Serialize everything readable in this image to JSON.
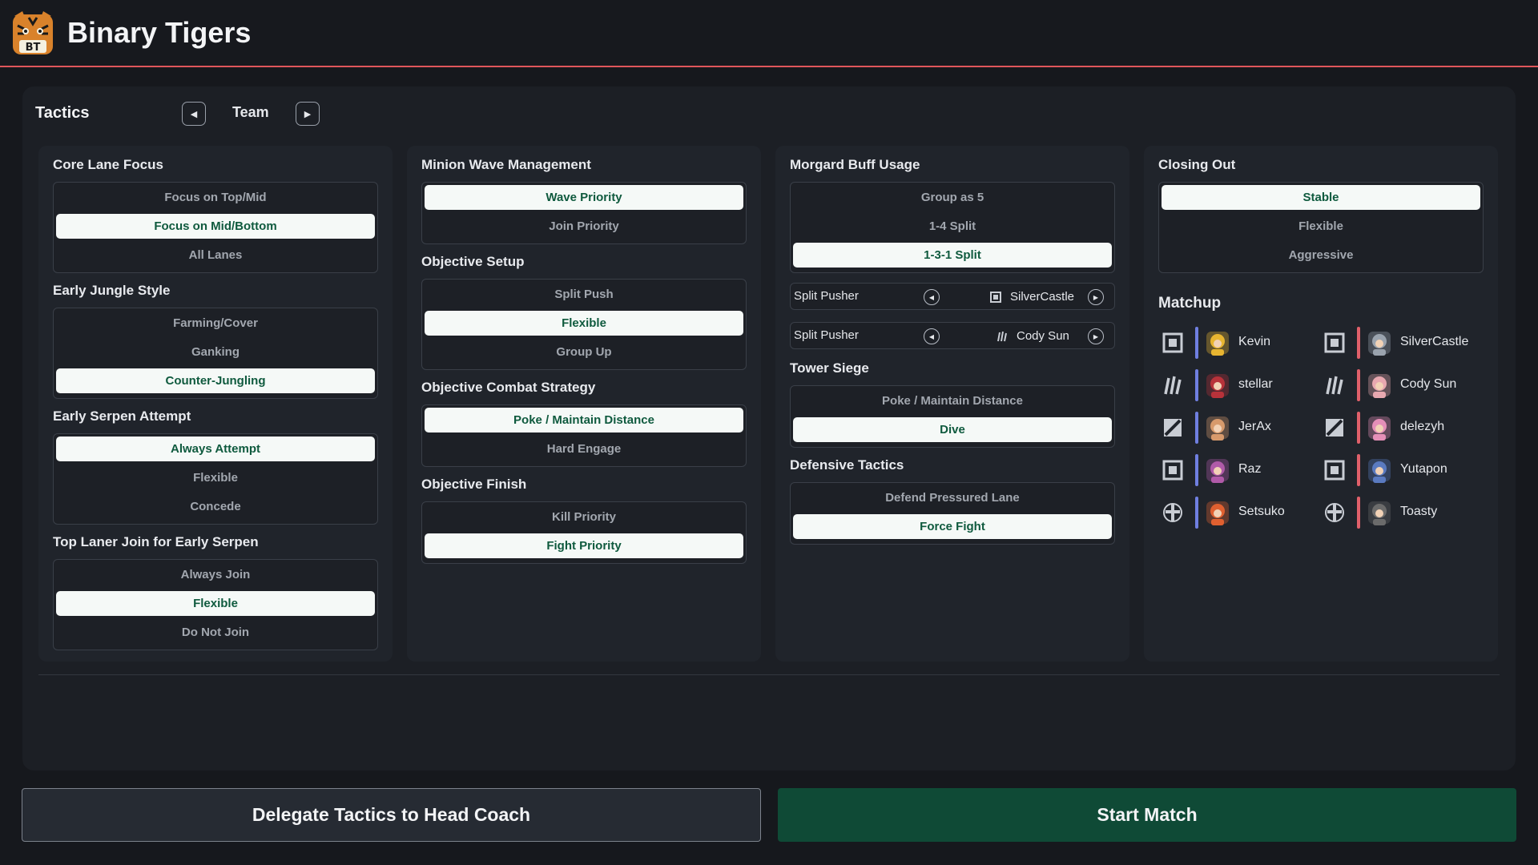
{
  "header": {
    "title": "Binary Tigers",
    "logo": "tiger-logo",
    "logo_text": "BT"
  },
  "tactics": {
    "title": "Tactics",
    "mode": "Team"
  },
  "columns": [
    {
      "sections": [
        {
          "title": "Core Lane Focus",
          "options": [
            "Focus on Top/Mid",
            "Focus on Mid/Bottom",
            "All Lanes"
          ],
          "selected": 1
        },
        {
          "title": "Early Jungle Style",
          "options": [
            "Farming/Cover",
            "Ganking",
            "Counter-Jungling"
          ],
          "selected": 2
        },
        {
          "title": "Early Serpen Attempt",
          "options": [
            "Always Attempt",
            "Flexible",
            "Concede"
          ],
          "selected": 0
        },
        {
          "title": "Top Laner Join for Early Serpen",
          "options": [
            "Always Join",
            "Flexible",
            "Do Not Join"
          ],
          "selected": 1
        }
      ]
    },
    {
      "sections": [
        {
          "title": "Minion Wave Management",
          "options": [
            "Wave Priority",
            "Join Priority"
          ],
          "selected": 0
        },
        {
          "title": "Objective Setup",
          "options": [
            "Split Push",
            "Flexible",
            "Group Up"
          ],
          "selected": 1
        },
        {
          "title": "Objective Combat Strategy",
          "options": [
            "Poke / Maintain Distance",
            "Hard Engage"
          ],
          "selected": 0
        },
        {
          "title": "Objective Finish",
          "options": [
            "Kill Priority",
            "Fight Priority"
          ],
          "selected": 1
        }
      ]
    },
    {
      "sections": [
        {
          "title": "Morgard Buff Usage",
          "options": [
            "Group as 5",
            "1-4 Split",
            "1-3-1 Split"
          ],
          "selected": 2
        },
        {
          "title": "Tower Siege",
          "options": [
            "Poke / Maintain Distance",
            "Dive"
          ],
          "selected": 1
        },
        {
          "title": "Defensive Tactics",
          "options": [
            "Defend Pressured Lane",
            "Force Fight"
          ],
          "selected": 1
        }
      ],
      "split_pushers": [
        {
          "label": "Split Pusher",
          "player": "SilverCastle",
          "role_icon": "lane-square-icon"
        },
        {
          "label": "Split Pusher",
          "player": "Cody Sun",
          "role_icon": "claw-icon"
        }
      ]
    },
    {
      "sections": [
        {
          "title": "Closing Out",
          "options": [
            "Stable",
            "Flexible",
            "Aggressive"
          ],
          "selected": 0
        }
      ]
    }
  ],
  "matchup": {
    "title": "Matchup",
    "colors": {
      "ally": "#6f7fe0",
      "enemy": "#e0606a"
    },
    "ally": [
      {
        "name": "Kevin",
        "role": "lane-square-icon",
        "avatar": "#e8b531"
      },
      {
        "name": "stellar",
        "role": "claw-icon",
        "avatar": "#b8323a"
      },
      {
        "name": "JerAx",
        "role": "slash-icon",
        "avatar": "#d79a6c"
      },
      {
        "name": "Raz",
        "role": "lane-square-icon",
        "avatar": "#b05aa8"
      },
      {
        "name": "Setsuko",
        "role": "cross-shield-icon",
        "avatar": "#e06030"
      }
    ],
    "enemy": [
      {
        "name": "SilverCastle",
        "role": "lane-square-icon",
        "avatar": "#9aa3ae"
      },
      {
        "name": "Cody Sun",
        "role": "claw-icon",
        "avatar": "#e8a8b0"
      },
      {
        "name": "delezyh",
        "role": "slash-icon",
        "avatar": "#e58fb8"
      },
      {
        "name": "Yutapon",
        "role": "lane-square-icon",
        "avatar": "#5a7ac0"
      },
      {
        "name": "Toasty",
        "role": "cross-shield-icon",
        "avatar": "#6b6b6b"
      }
    ]
  },
  "actions": {
    "delegate": "Delegate Tactics to Head Coach",
    "start": "Start Match"
  }
}
